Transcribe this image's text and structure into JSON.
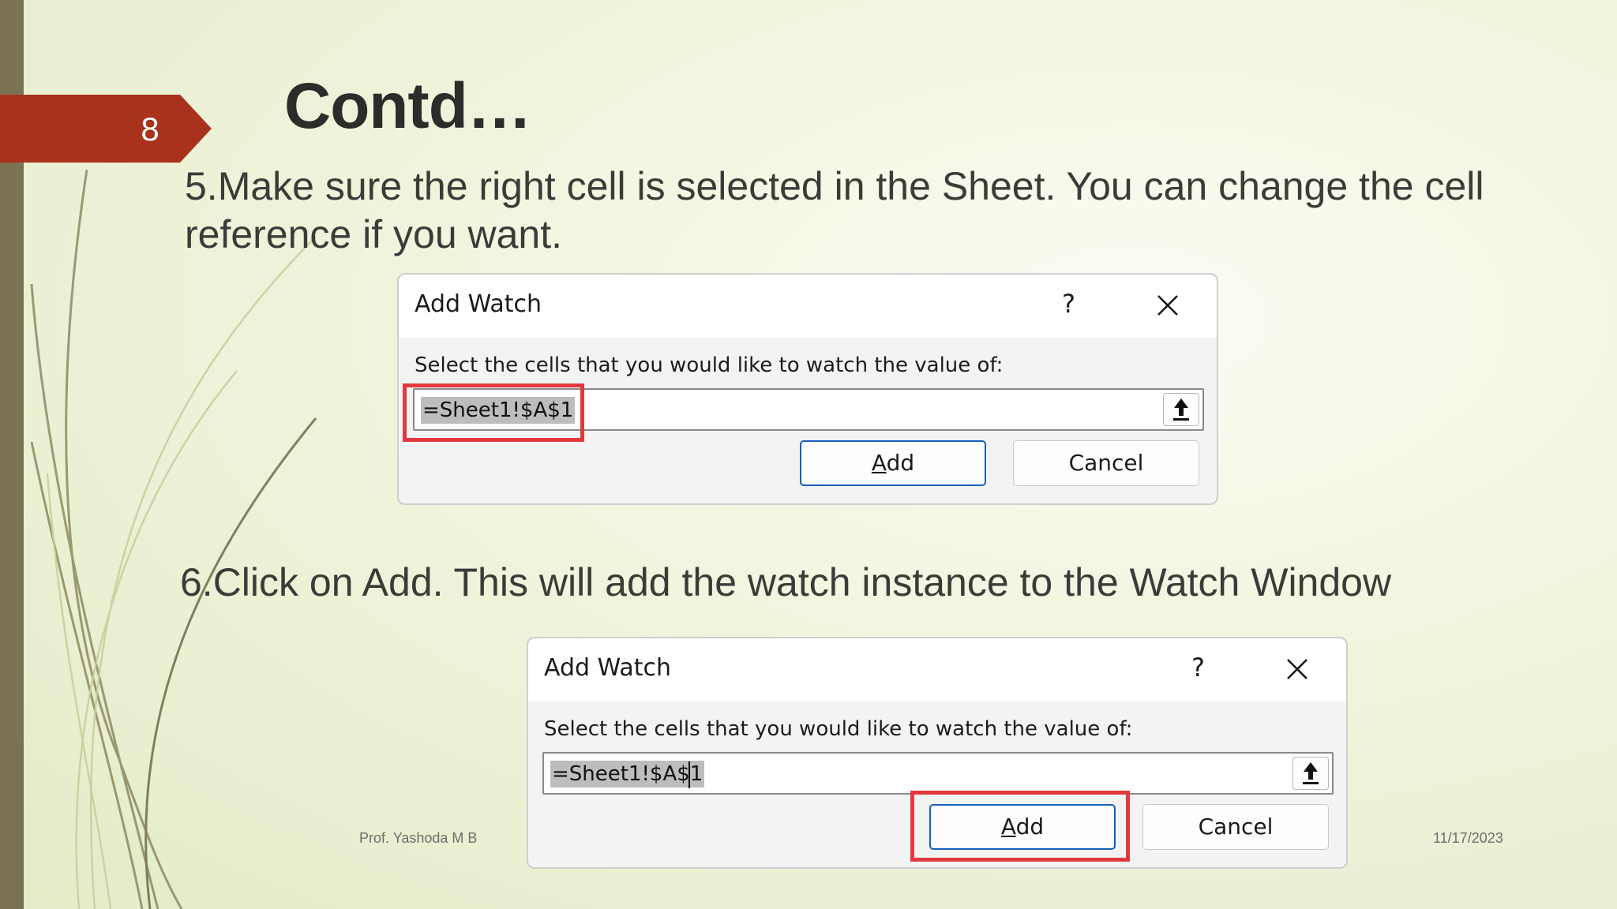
{
  "slide": {
    "number": "8",
    "title": "Contd…",
    "step5": "5.Make sure the right cell is selected in the Sheet. You can change the cell reference if you want.",
    "step6": "6.Click on Add. This will add the watch instance to the Watch Window",
    "footer_author": "Prof. Yashoda M B",
    "footer_date": "11/17/2023"
  },
  "dialog1": {
    "title": "Add Watch",
    "help": "?",
    "prompt": "Select the cells that you would like to watch the value of:",
    "input_value": "=Sheet1!$A$1",
    "add_label_prefix": "",
    "add_label_underlined": "A",
    "add_label_rest": "dd",
    "cancel_label": "Cancel"
  },
  "dialog2": {
    "title": "Add Watch",
    "help": "?",
    "prompt": "Select the cells that you would like to watch the value of:",
    "input_value": "=Sheet1!$A$1",
    "add_label_underlined": "A",
    "add_label_rest": "dd",
    "cancel_label": "Cancel"
  },
  "colors": {
    "accent_red": "#a8321c",
    "highlight": "#e2393f",
    "primary_button_border": "#1560ba",
    "sidebar": "#7a7353"
  },
  "icons": [
    "close-icon",
    "collapse-dialog-icon",
    "slide-number-arrow"
  ]
}
